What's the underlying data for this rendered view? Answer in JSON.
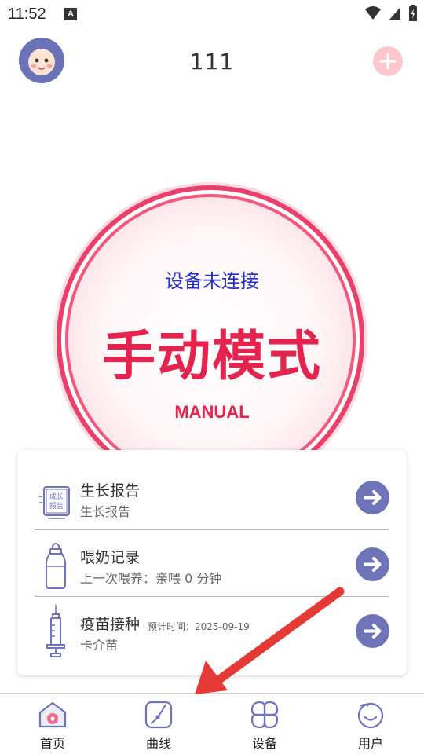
{
  "status_bar": {
    "time": "11:52",
    "notification_badge": "A",
    "icons": [
      "wifi-icon",
      "signal-icon",
      "battery-icon"
    ]
  },
  "header": {
    "title": "111",
    "avatar_icon": "baby-face-icon",
    "add_icon": "plus-icon"
  },
  "main_circle": {
    "status_text": "设备未连接",
    "mode_text": "手动模式",
    "mode_sub": "MANUAL"
  },
  "records": [
    {
      "icon": "growth-report-icon",
      "icon_text_1": "成长",
      "icon_text_2": "报告",
      "title": "生长报告",
      "subtitle": "生长报告",
      "note": ""
    },
    {
      "icon": "baby-bottle-icon",
      "title": "喂奶记录",
      "subtitle": "上一次喂养：亲喂 0 分钟",
      "note": ""
    },
    {
      "icon": "syringe-icon",
      "title": "疫苗接种",
      "subtitle": "卡介苗",
      "note": "预计时间：2025-09-19"
    }
  ],
  "bottom_nav": [
    {
      "label": "首页",
      "icon": "home-icon"
    },
    {
      "label": "曲线",
      "icon": "curve-icon"
    },
    {
      "label": "设备",
      "icon": "device-icon"
    },
    {
      "label": "用户",
      "icon": "user-icon"
    }
  ],
  "colors": {
    "accent_pink": "#e4234f",
    "status_blue": "#2430c8",
    "nav_icon": "#6f74b8",
    "add_button": "#ffc7cd",
    "annotation_arrow": "#e53935"
  }
}
